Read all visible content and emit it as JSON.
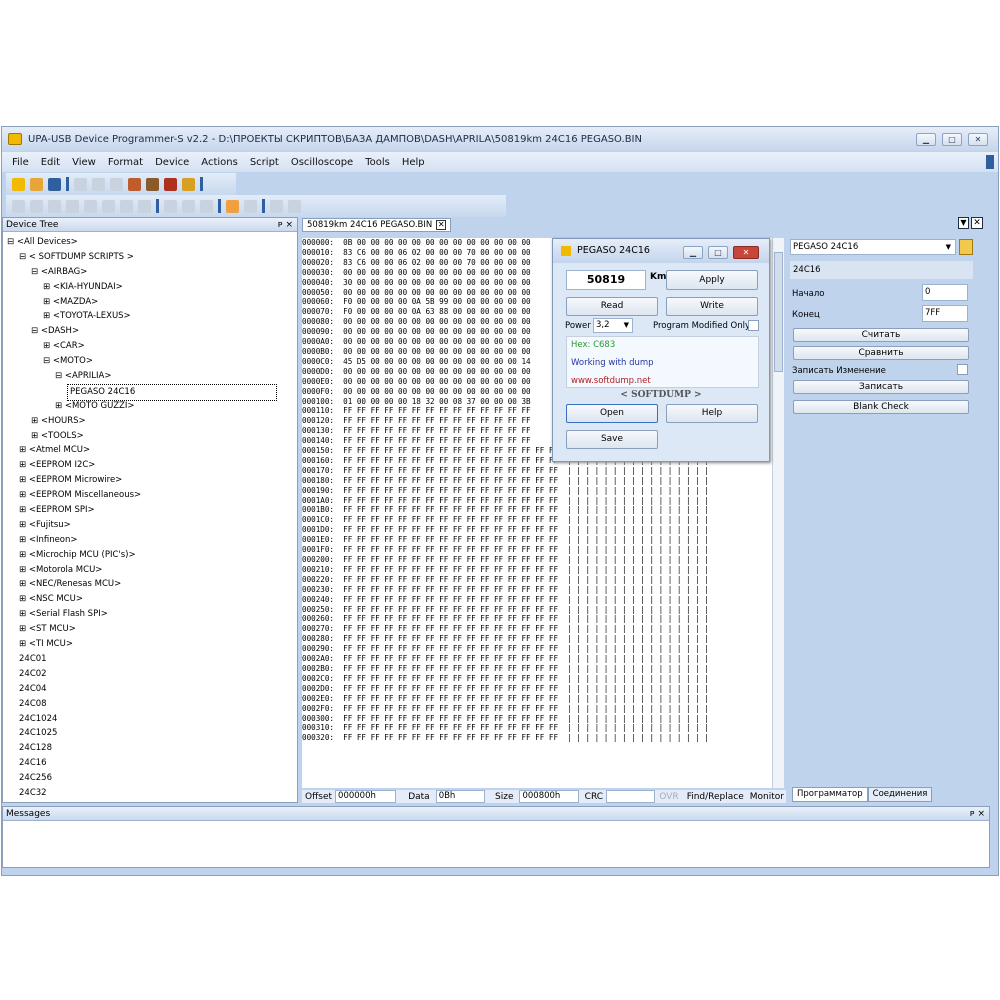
{
  "window": {
    "title": "UPA-USB Device Programmer-S v2.2 - D:\\ПРОЕКТЫ СКРИПТОВ\\БАЗА ДАМПОВ\\DASH\\APRILA\\50819km 24C16 PEGASO.BIN"
  },
  "menu": [
    "File",
    "Edit",
    "View",
    "Format",
    "Device",
    "Actions",
    "Script",
    "Oscilloscope",
    "Tools",
    "Help"
  ],
  "device_tree": {
    "title": "Device Tree",
    "pin": "ᴘ ×",
    "items": [
      "<All Devices>",
      "< SOFTDUMP SCRIPTS >",
      "<AIRBAG>",
      "<KIA-HYUNDAI>",
      "<MAZDA>",
      "<TOYOTA-LEXUS>",
      "<DASH>",
      "<CAR>",
      "<MOTO>",
      "<APRILIA>",
      "PEGASO 24C16",
      "<MOTO GUZZI>",
      "<HOURS>",
      "<TOOLS>",
      "<Atmel MCU>",
      "<EEPROM I2C>",
      "<EEPROM Microwire>",
      "<EEPROM Miscellaneous>",
      "<EEPROM SPI>",
      "<Fujitsu>",
      "<Infineon>",
      "<Microchip MCU (PIC's)>",
      "<Motorola MCU>",
      "<NEC/Renesas MCU>",
      "<NSC MCU>",
      "<Serial Flash SPI>",
      "<ST MCU>",
      "<TI MCU>",
      "24C01",
      "24C02",
      "24C04",
      "24C08",
      "24C1024",
      "24C1025",
      "24C128",
      "24C16",
      "24C256",
      "24C32"
    ]
  },
  "editor": {
    "tab": "50819km 24C16 PEGASO.BIN",
    "hex_lines": [
      "000000:  0B 00 00 00 00 00 00 00 00 00 00 00 00 00",
      "000010:  83 C6 00 00 06 02 00 00 00 70 00 00 00 00",
      "000020:  83 C6 00 00 06 02 00 00 00 70 00 00 00 00",
      "000030:  00 00 00 00 00 00 00 00 00 00 00 00 00 00",
      "000040:  30 00 00 00 00 00 00 00 00 00 00 00 00 00",
      "000050:  00 00 00 00 00 00 00 00 00 00 00 00 00 00",
      "000060:  F0 00 00 00 00 0A 5B 99 00 00 00 00 00 00",
      "000070:  F0 00 00 00 00 0A 63 88 00 00 00 00 00 00",
      "000080:  00 00 00 00 00 00 00 00 00 00 00 00 00 00",
      "000090:  00 00 00 00 00 00 00 00 00 00 00 00 00 00",
      "0000A0:  00 00 00 00 00 00 00 00 00 00 00 00 00 00",
      "0000B0:  00 00 00 00 00 00 00 00 00 00 00 00 00 00",
      "0000C0:  45 D5 00 00 00 00 00 00 00 00 00 00 00 14",
      "0000D0:  00 00 00 00 00 00 00 00 00 00 00 00 00 00",
      "0000E0:  00 00 00 00 00 00 00 00 00 00 00 00 00 00",
      "0000F0:  00 00 00 00 00 00 00 00 00 00 00 00 00 00",
      "000100:  01 00 00 00 00 18 32 00 08 37 00 00 00 3B",
      "000110:  FF FF FF FF FF FF FF FF FF FF FF FF FF FF",
      "000120:  FF FF FF FF FF FF FF FF FF FF FF FF FF FF",
      "000130:  FF FF FF FF FF FF FF FF FF FF FF FF FF FF",
      "000140:  FF FF FF FF FF FF FF FF FF FF FF FF FF FF",
      "000150:  FF FF FF FF FF FF FF FF FF FF FF FF FF FF FF FF  | | | | | | | | | | | | | | | |",
      "000160:  FF FF FF FF FF FF FF FF FF FF FF FF FF FF FF FF  | | | | | | | | | | | | | | | |",
      "000170:  FF FF FF FF FF FF FF FF FF FF FF FF FF FF FF FF  | | | | | | | | | | | | | | | |",
      "000180:  FF FF FF FF FF FF FF FF FF FF FF FF FF FF FF FF  | | | | | | | | | | | | | | | |",
      "000190:  FF FF FF FF FF FF FF FF FF FF FF FF FF FF FF FF  | | | | | | | | | | | | | | | |",
      "0001A0:  FF FF FF FF FF FF FF FF FF FF FF FF FF FF FF FF  | | | | | | | | | | | | | | | |",
      "0001B0:  FF FF FF FF FF FF FF FF FF FF FF FF FF FF FF FF  | | | | | | | | | | | | | | | |",
      "0001C0:  FF FF FF FF FF FF FF FF FF FF FF FF FF FF FF FF  | | | | | | | | | | | | | | | |",
      "0001D0:  FF FF FF FF FF FF FF FF FF FF FF FF FF FF FF FF  | | | | | | | | | | | | | | | |",
      "0001E0:  FF FF FF FF FF FF FF FF FF FF FF FF FF FF FF FF  | | | | | | | | | | | | | | | |",
      "0001F0:  FF FF FF FF FF FF FF FF FF FF FF FF FF FF FF FF  | | | | | | | | | | | | | | | |",
      "000200:  FF FF FF FF FF FF FF FF FF FF FF FF FF FF FF FF  | | | | | | | | | | | | | | | |",
      "000210:  FF FF FF FF FF FF FF FF FF FF FF FF FF FF FF FF  | | | | | | | | | | | | | | | |",
      "000220:  FF FF FF FF FF FF FF FF FF FF FF FF FF FF FF FF  | | | | | | | | | | | | | | | |",
      "000230:  FF FF FF FF FF FF FF FF FF FF FF FF FF FF FF FF  | | | | | | | | | | | | | | | |",
      "000240:  FF FF FF FF FF FF FF FF FF FF FF FF FF FF FF FF  | | | | | | | | | | | | | | | |",
      "000250:  FF FF FF FF FF FF FF FF FF FF FF FF FF FF FF FF  | | | | | | | | | | | | | | | |",
      "000260:  FF FF FF FF FF FF FF FF FF FF FF FF FF FF FF FF  | | | | | | | | | | | | | | | |",
      "000270:  FF FF FF FF FF FF FF FF FF FF FF FF FF FF FF FF  | | | | | | | | | | | | | | | |",
      "000280:  FF FF FF FF FF FF FF FF FF FF FF FF FF FF FF FF  | | | | | | | | | | | | | | | |",
      "000290:  FF FF FF FF FF FF FF FF FF FF FF FF FF FF FF FF  | | | | | | | | | | | | | | | |",
      "0002A0:  FF FF FF FF FF FF FF FF FF FF FF FF FF FF FF FF  | | | | | | | | | | | | | | | |",
      "0002B0:  FF FF FF FF FF FF FF FF FF FF FF FF FF FF FF FF  | | | | | | | | | | | | | | | |",
      "0002C0:  FF FF FF FF FF FF FF FF FF FF FF FF FF FF FF FF  | | | | | | | | | | | | | | | |",
      "0002D0:  FF FF FF FF FF FF FF FF FF FF FF FF FF FF FF FF  | | | | | | | | | | | | | | | |",
      "0002E0:  FF FF FF FF FF FF FF FF FF FF FF FF FF FF FF FF  | | | | | | | | | | | | | | | |",
      "0002F0:  FF FF FF FF FF FF FF FF FF FF FF FF FF FF FF FF  | | | | | | | | | | | | | | | |",
      "000300:  FF FF FF FF FF FF FF FF FF FF FF FF FF FF FF FF  | | | | | | | | | | | | | | | |",
      "000310:  FF FF FF FF FF FF FF FF FF FF FF FF FF FF FF FF  | | | | | | | | | | | | | | | |",
      "000320:  FF FF FF FF FF FF FF FF FF FF FF FF FF FF FF FF  | | | | | | | | | | | | | | | |"
    ],
    "status": {
      "offset_label": "Offset",
      "offset": "000000h",
      "data_label": "Data",
      "data": "0Bh",
      "size_label": "Size",
      "size": "000800h",
      "crc_label": "CRC",
      "ovr": "OVR",
      "find": "Find/Replace",
      "monitor": "Monitor"
    }
  },
  "dialog": {
    "title": "PEGASO 24C16",
    "km_value": "50819",
    "km_label": "Km",
    "apply": "Apply",
    "read": "Read",
    "write": "Write",
    "power_label": "Power",
    "power_value": "3,2",
    "program_modified": "Program Modified Only",
    "hex_info": "Hex: C683",
    "working": "Working with dump",
    "site": "www.softdump.net",
    "softdump": "< SOFTDUMP >",
    "open": "Open",
    "help": "Help",
    "save": "Save"
  },
  "right_panel": {
    "device": "PEGASO 24C16",
    "chip": "24C16",
    "start_label": "Начало",
    "start_value": "0",
    "end_label": "Конец",
    "end_value": "7FF",
    "read_btn": "Считать",
    "compare_btn": "Сравнить",
    "write_change_label": "Записать Изменение",
    "write_btn": "Записать",
    "blank_btn": "Blank Check",
    "tab1": "Программатор",
    "tab2": "Соединения"
  },
  "messages": {
    "title": "Messages"
  }
}
